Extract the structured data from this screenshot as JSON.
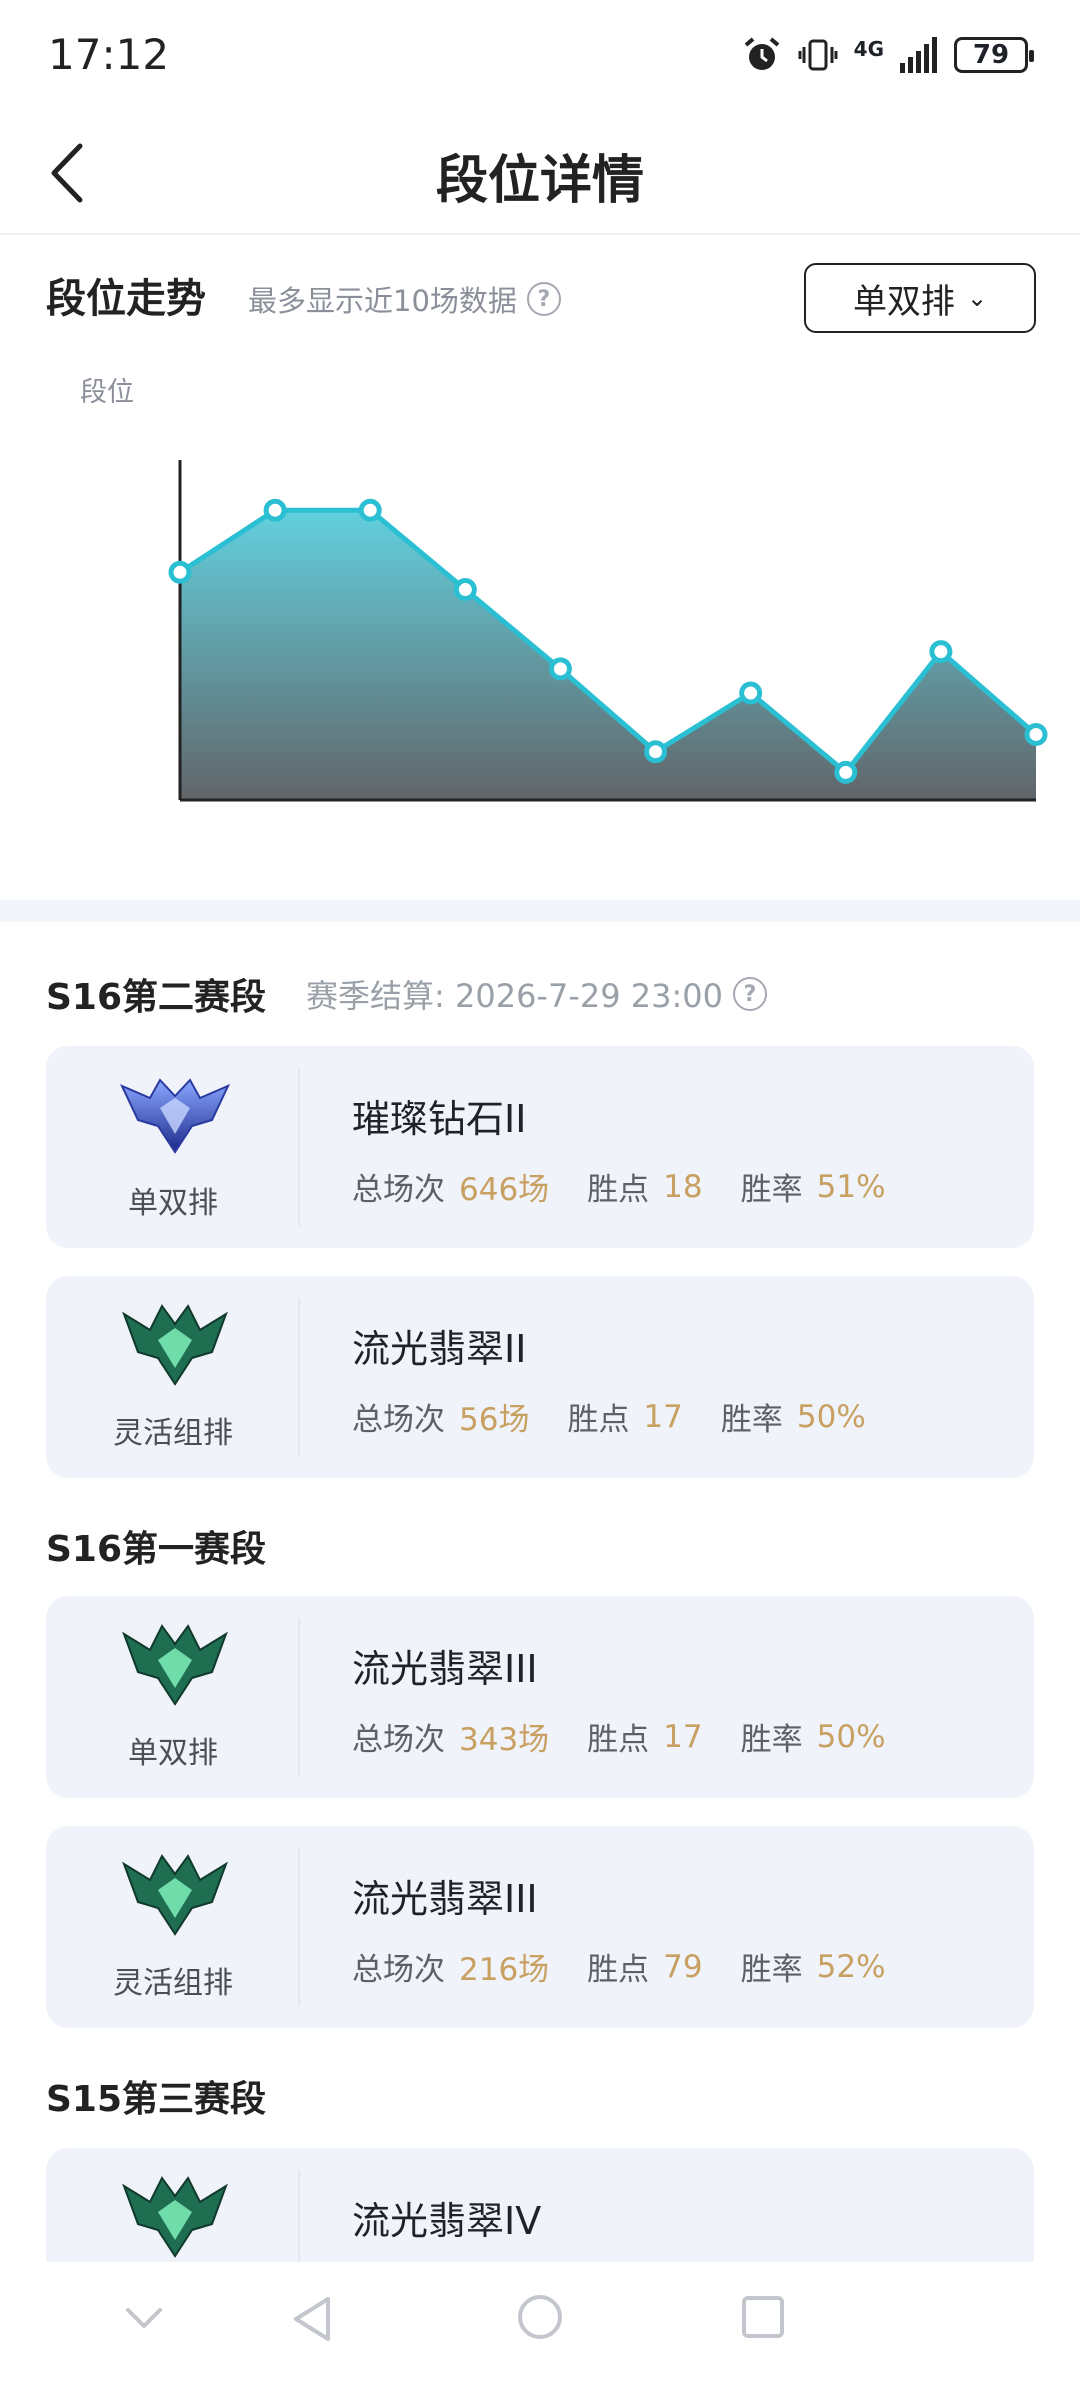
{
  "status_bar": {
    "time": "17:12",
    "network": "4G",
    "battery": "79"
  },
  "nav": {
    "title": "段位详情"
  },
  "trend": {
    "title": "段位走势",
    "hint": "最多显示近10场数据",
    "mode_select": "单双排",
    "y_axis_label": "段位"
  },
  "chart_data": {
    "type": "area",
    "x": [
      1,
      2,
      3,
      4,
      5,
      6,
      7,
      8,
      9,
      10
    ],
    "values": [
      66,
      84,
      84,
      61,
      38,
      14,
      31,
      8,
      43,
      19
    ],
    "ylim": [
      0,
      100
    ],
    "colors": {
      "line": "#2bbfd3",
      "fill_top": "#62d0de",
      "fill_bottom": "#616569"
    },
    "grid": false
  },
  "seasons": [
    {
      "name": "S16第二赛段",
      "settle": "赛季结算: 2026-7-29 23:00",
      "cards": [
        {
          "emblem": "diamond-emblem-icon",
          "mode": "单双排",
          "rank": "璀璨钻石II",
          "games_label": "总场次",
          "games": "646场",
          "points_label": "胜点",
          "points": "18",
          "winrate_label": "胜率",
          "winrate": "51%"
        },
        {
          "emblem": "emerald-emblem-icon",
          "mode": "灵活组排",
          "rank": "流光翡翠II",
          "games_label": "总场次",
          "games": "56场",
          "points_label": "胜点",
          "points": "17",
          "winrate_label": "胜率",
          "winrate": "50%"
        }
      ]
    },
    {
      "name": "S16第一赛段",
      "cards": [
        {
          "emblem": "emerald-emblem-icon",
          "mode": "单双排",
          "rank": "流光翡翠III",
          "games_label": "总场次",
          "games": "343场",
          "points_label": "胜点",
          "points": "17",
          "winrate_label": "胜率",
          "winrate": "50%"
        },
        {
          "emblem": "emerald-emblem-icon",
          "mode": "灵活组排",
          "rank": "流光翡翠III",
          "games_label": "总场次",
          "games": "216场",
          "points_label": "胜点",
          "points": "79",
          "winrate_label": "胜率",
          "winrate": "52%"
        }
      ]
    },
    {
      "name": "S15第三赛段",
      "cards": [
        {
          "emblem": "emerald-emblem-icon",
          "rank": "流光翡翠IV"
        }
      ]
    }
  ]
}
